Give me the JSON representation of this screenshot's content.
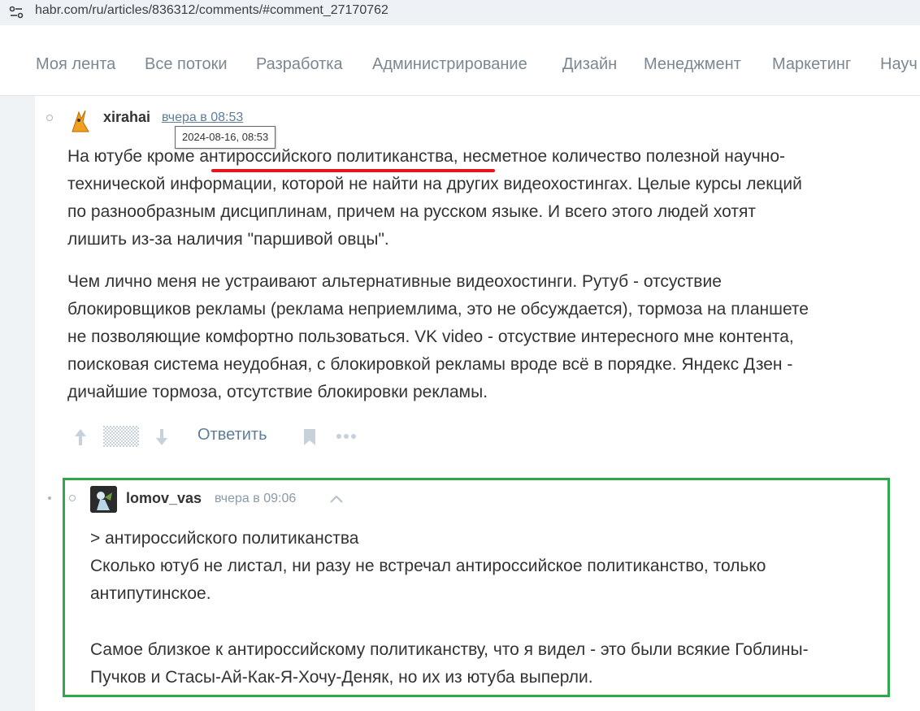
{
  "browser": {
    "url": "habr.com/ru/articles/836312/comments/#comment_27170762"
  },
  "nav": {
    "items": [
      "Моя лента",
      "Все потоки",
      "Разработка",
      "Администрирование",
      "Дизайн",
      "Менеджмент",
      "Маркетинг",
      "Науч"
    ]
  },
  "comment1": {
    "author": "xirahai",
    "time": "вчера в 08:53",
    "tooltip": "2024-08-16, 08:53",
    "p1": [
      {
        "before": "На ютубе кроме ",
        "highlight": "антироссийского политиканства",
        "after": ", несметное количество полезной научно-"
      },
      "технической информации, которой не найти на других видеохостингах. Целые курсы лекций",
      "по разнообразным дисциплинам, причем на русском языке. И всего этого людей хотят",
      "лишить из-за наличия \"паршивой овцы\"."
    ],
    "p2": [
      "Чем лично меня не устраивают альтернативные видеохостинги. Рутуб - отсуствие",
      "блокировщиков рекламы (реклама неприемлима, это не обсуждается), тормоза на планшете",
      "не позволяющие комфортно пользоваться. VK video - отсуствие интересного мне контента,",
      "поисковая система неудобная, с блокировкой рекламы вроде всё в порядке. Яндекс Дзен -",
      "дичайшие тормоза, отсутствие блокировки рекламы."
    ],
    "reply_label": "Ответить"
  },
  "comment2": {
    "author": "lomov_vas",
    "time": "вчера в 09:06",
    "quote": "> антироссийского политиканства",
    "lines1": [
      "Сколько ютуб не листал, ни разу не встречал антироссийское политиканство, только",
      "антипутинское."
    ],
    "lines2": [
      "Самое близкое к антироссийскому политиканству, что я видел - это были всякие Гоблины-",
      "Пучков и Стасы-Ай-Как-Я-Хочу-Деняк, но их из ютуба выперли."
    ]
  },
  "colors": {
    "accent_link": "#5e7e98",
    "highlight_box": "#2ea84a",
    "underline": "#e8141c"
  }
}
